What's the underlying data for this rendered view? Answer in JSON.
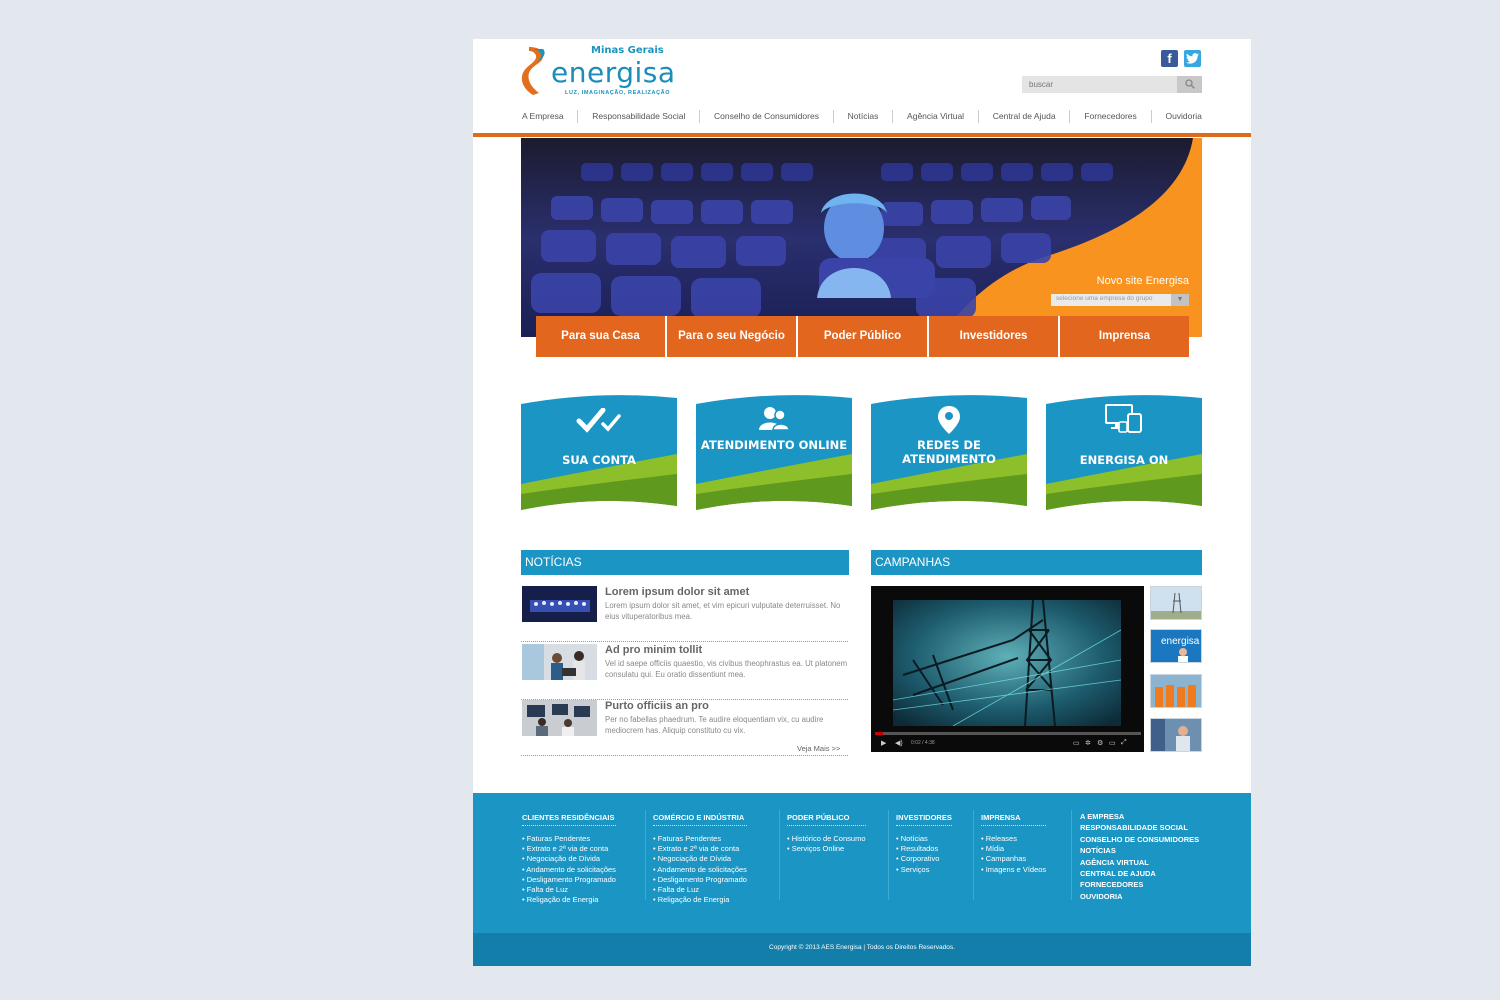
{
  "header": {
    "region": "Minas Gerais",
    "brand": "energisa",
    "tagline": "LUZ, IMAGINAÇÃO, REALIZAÇÃO",
    "search_placeholder": "buscar",
    "facebook_icon": "facebook-icon",
    "twitter_icon": "twitter-icon"
  },
  "nav": [
    "A Empresa",
    "Responsabilidade Social",
    "Conselho de Consumidores",
    "Notícias",
    "Agência Virtual",
    "Central de Ajuda",
    "Fornecedores",
    "Ouvidoria"
  ],
  "hero": {
    "caption": "Novo site Energisa",
    "select_placeholder": "selecione uma empresa do grupo"
  },
  "tabs": [
    "Para sua Casa",
    "Para o seu Negócio",
    "Poder Público",
    "Investidores",
    "Imprensa"
  ],
  "services": [
    {
      "label": "SUA CONTA",
      "icon": "double-check-icon"
    },
    {
      "label": "ATENDIMENTO ONLINE",
      "icon": "users-icon"
    },
    {
      "label": "REDES DE ATENDIMENTO",
      "icon": "map-pin-icon"
    },
    {
      "label": "ENERGISA ON",
      "icon": "devices-icon"
    }
  ],
  "news": {
    "heading": "NOTÍCIAS",
    "items": [
      {
        "title": "Lorem ipsum dolor sit amet",
        "text": "Lorem ipsum dolor sit amet, et vim epicuri vulputate deterruisset. No eius vituperatoribus mea."
      },
      {
        "title": "Ad pro minim tollit",
        "text": "Vel id saepe officiis quaestio, vis civibus theophrastus ea. Ut platonem consulatu qui. Eu oratio dissentiunt mea."
      },
      {
        "title": "Purto officiis an pro",
        "text": "Per no fabellas phaedrum. Te audire eloquentiam vix, cu audire mediocrem has. Aliquip constituto cu vix."
      }
    ],
    "more": "Veja Mais >>"
  },
  "campaigns": {
    "heading": "CAMPANHAS",
    "video_time": "0:02 / 4:38",
    "video_progress": 0.03
  },
  "footer": {
    "columns": [
      {
        "title": "CLIENTES RESIDÊNCIAIS",
        "items": [
          "• Faturas Pendentes",
          "• Extrato e 2ª via de conta",
          "• Negociação de Dívida",
          "• Andamento de solicitações",
          "• Desligamento Programado",
          "• Falta de Luz",
          "• Religação de Energia"
        ]
      },
      {
        "title": "COMÉRCIO E INDÚSTRIA",
        "items": [
          "• Faturas Pendentes",
          "• Extrato e 2ª via de conta",
          "• Negociação de Dívida",
          "• Andamento de solicitações",
          "• Desligamento Programado",
          "• Falta de Luz",
          "• Religação de Energia"
        ]
      },
      {
        "title": "PODER PÚBLICO",
        "items": [
          "• Histórico de Consumo",
          "• Serviços Online"
        ]
      },
      {
        "title": "INVESTIDORES",
        "items": [
          "• Notícias",
          "• Resultados",
          "• Corporativo",
          "• Serviços"
        ]
      },
      {
        "title": "IMPRENSA",
        "items": [
          "• Releases",
          "• Mídia",
          "• Campanhas",
          "• Imagens e Vídeos"
        ]
      }
    ],
    "links": [
      "A EMPRESA",
      "RESPONSABILIDADE SOCIAL",
      "CONSELHO DE CONSUMIDORES",
      "NOTÍCIAS",
      "AGÊNCIA VIRTUAL",
      "CENTRAL DE AJUDA",
      "FORNECEDORES",
      "OUVIDORIA"
    ],
    "copyright": "Copyright © 2013 AES Energisa | Todos os Direitos Reservados."
  }
}
